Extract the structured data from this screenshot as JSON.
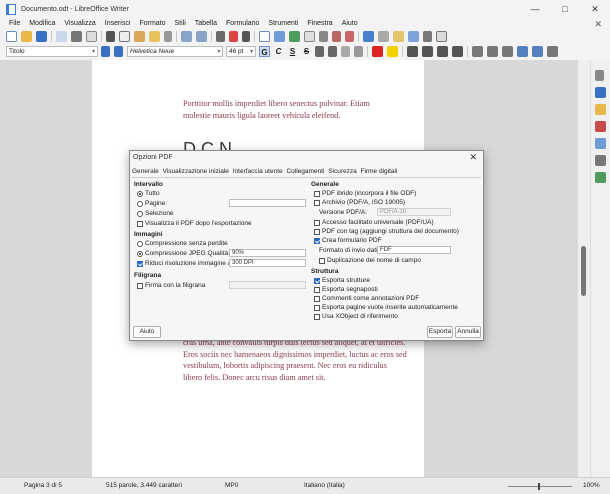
{
  "window": {
    "title": "Documento.odt - LibreOffice Writer"
  },
  "menu": [
    "File",
    "Modifica",
    "Visualizza",
    "Inserisci",
    "Formato",
    "Stili",
    "Tabella",
    "Formulario",
    "Strumenti",
    "Finestra",
    "Aiuto"
  ],
  "format_bar": {
    "style": "Titolo",
    "font": "Helvetica Neue",
    "size": "46 pt",
    "bold": "G",
    "italic": "C",
    "underline": "S",
    "strike": "S"
  },
  "document": {
    "para1": "Porttitor mollis imperdiet libero senectus pulvinar. Etiam molestie mauris ligula laoreet vehicula eleifend.",
    "heading_fragment": "D      C   N",
    "para2": "cras urna, ante convallis turpis duis lectus sed aliquet, at et ultricies. Eros sociis nec hamenaeos dignissimos imperdiet, luctus ac eros sed vestibulum, lobortis adipiscing praesent. Nec eros eu ridiculus libero felis. Donec arcu risus diam amet sit."
  },
  "dialog": {
    "title": "Opzioni PDF",
    "tabs": [
      "Generale",
      "Visualizzazione iniziale",
      "Interfaccia utente",
      "Collegamenti",
      "Sicurezza",
      "Firme digitali"
    ],
    "intervallo": {
      "heading": "Intervallo",
      "tutto": "Tutto",
      "pagine": "Pagine:",
      "selezione": "Selezione",
      "visualizza": "Visualizza il PDF dopo l'esportazione"
    },
    "immagini": {
      "heading": "Immagini",
      "senza_perdite": "Compressione senza perdite",
      "jpeg": "Compressione JPEG",
      "qualita": "Qualità:",
      "qualita_value": "90%",
      "riduci": "Riduci risoluzione immagine a:",
      "dpi_value": "300 DPI"
    },
    "filigrana": {
      "heading": "Filigrana",
      "firma": "Firma con la filigrana"
    },
    "generale": {
      "heading": "Generale",
      "pdf_ibrido": "PDF ibrido (incorpora il file ODF)",
      "archivio": "Archivio (PDF/A, ISO 19005)",
      "versione_label": "Versione PDF/A:",
      "versione_value": "PDF/A-1b",
      "accesso": "Accesso facilitato universale (PDF/UA)",
      "pdf_tag": "PDF con tag (aggiungi struttura del documento)",
      "crea_formulario": "Crea formulario PDF",
      "formato_label": "Formato di invio dati:",
      "formato_value": "FDF",
      "duplicazione": "Duplicazione dei nome di campo"
    },
    "struttura": {
      "heading": "Struttura",
      "esporta_strutture": "Esporta strutture",
      "esporta_segnaposti": "Esporta segnaposti",
      "commenti": "Commenti come annotazioni PDF",
      "pagine_vuote": "Esporta pagine vuote inserite automaticamente",
      "xobject": "Usa XObject di riferimento"
    },
    "buttons": {
      "help": "Aiuto",
      "export": "Esporta",
      "cancel": "Annulla"
    }
  },
  "status": {
    "page": "Pagina 3 di 5",
    "words": "515 parole, 3.449 caratteri",
    "style": "MP0",
    "language": "Italiano (Italia)",
    "zoom": "100%"
  },
  "colors": {
    "text_accent": "#8b3a4a",
    "checkbox_on": "#2b68c8"
  }
}
